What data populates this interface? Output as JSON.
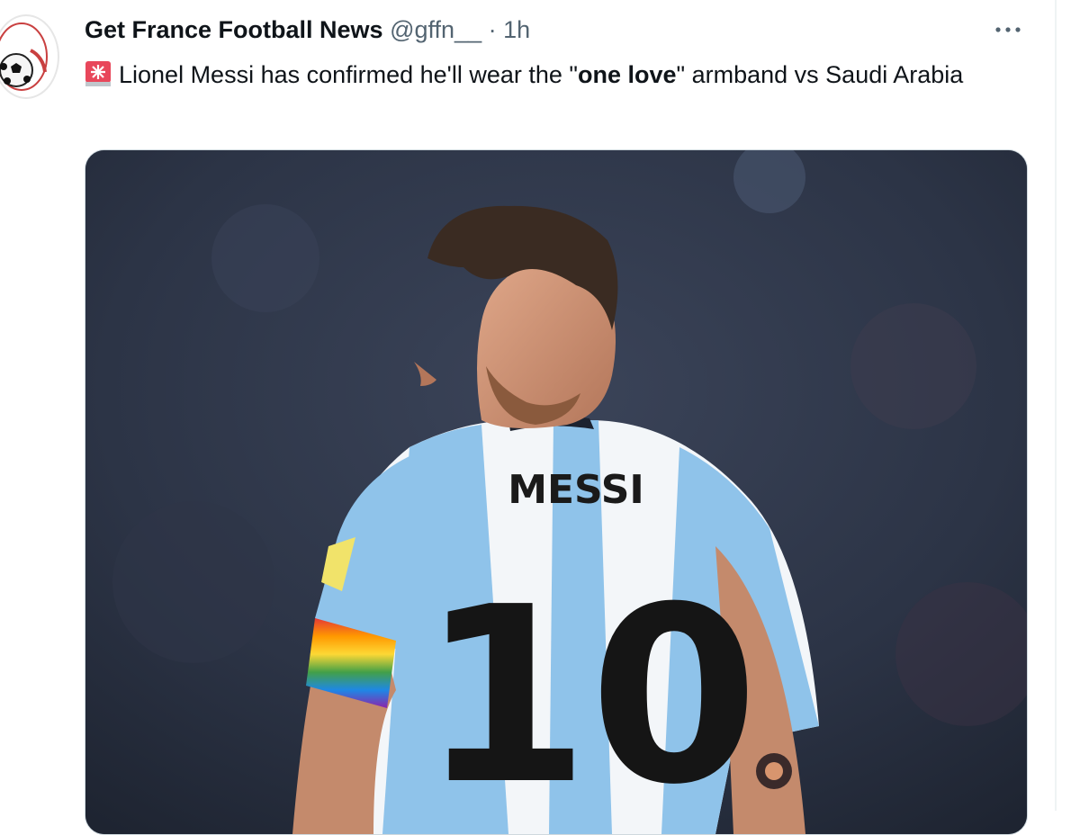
{
  "tweet": {
    "author_name": "Get France Football News",
    "handle": "@gffn__",
    "separator": "·",
    "time": "1h",
    "text_before": "Lionel Messi has confirmed he'll wear the \"",
    "text_bold": "one love",
    "text_after": "\" armband vs Saudi Arabia"
  },
  "media": {
    "jersey_name": "MESSI",
    "jersey_number": "10",
    "description_icon": "photo"
  },
  "icons": {
    "more": "more-horizontal-icon",
    "siren": "rotating-light-icon"
  },
  "colors": {
    "text_primary": "#0f1419",
    "text_secondary": "#536471",
    "border": "#cfd9de",
    "jersey_blue": "#8fc3ea"
  }
}
